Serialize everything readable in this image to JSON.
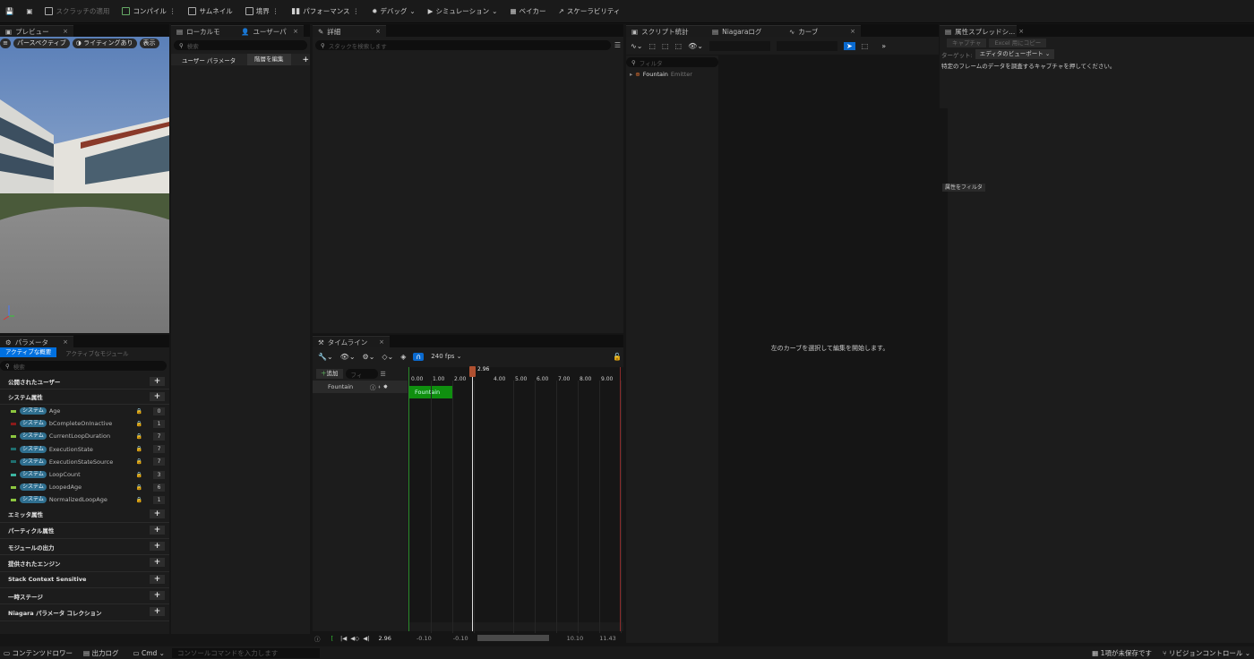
{
  "toolbar": {
    "items": [
      {
        "id": "scratch",
        "label": "スクラッチの適用",
        "disabled": true
      },
      {
        "id": "compile",
        "label": "コンパイル"
      },
      {
        "id": "thumbnail",
        "label": "サムネイル"
      },
      {
        "id": "bounds",
        "label": "境界"
      },
      {
        "id": "performance",
        "label": "パフォーマンス"
      },
      {
        "id": "debug",
        "label": "デバッグ"
      },
      {
        "id": "simulation",
        "label": "シミュレーション"
      },
      {
        "id": "baker",
        "label": "ベイカー"
      },
      {
        "id": "scalability",
        "label": "スケーラビリティ"
      }
    ]
  },
  "preview": {
    "tab_label": "プレビュー",
    "perspective_label": "パースペクティブ",
    "lighting_label": "ライティングあり",
    "show_label": "表示"
  },
  "local": {
    "tab1": "ローカルモ",
    "tab2": "ユーザーパ",
    "search_placeholder": "検索",
    "user_params_label": "ユーザー パラメータ",
    "edit_hierarchy_label": "階層を編集"
  },
  "details": {
    "tab_label": "詳細",
    "search_placeholder": "スタックを検索します"
  },
  "params": {
    "tab_label": "パラメータ",
    "active_overview": "アクティブな概要",
    "active_modules": "アクティブなモジュール",
    "search_placeholder": "検索",
    "cat_public_user": "公開されたユーザー",
    "cat_system": "システム属性",
    "rows": [
      {
        "tag": "システム",
        "name": "Age",
        "value": "0",
        "color": "#8cc63f"
      },
      {
        "tag": "システム",
        "name": "bCompleteOnInactive",
        "value": "1",
        "color": "#8b1a1a"
      },
      {
        "tag": "システム",
        "name": "CurrentLoopDuration",
        "value": "7",
        "color": "#8cc63f"
      },
      {
        "tag": "システム",
        "name": "ExecutionState",
        "value": "7",
        "color": "#1f6f6f"
      },
      {
        "tag": "システム",
        "name": "ExecutionStateSource",
        "value": "7",
        "color": "#1f6f6f"
      },
      {
        "tag": "システム",
        "name": "LoopCount",
        "value": "3",
        "color": "#3cb4a0"
      },
      {
        "tag": "システム",
        "name": "LoopedAge",
        "value": "6",
        "color": "#8cc63f"
      },
      {
        "tag": "システム",
        "name": "NormalizedLoopAge",
        "value": "1",
        "color": "#8cc63f"
      }
    ],
    "cats_after": [
      "エミッタ属性",
      "パーティクル属性",
      "モジュールの出力",
      "提供されたエンジン",
      "Stack Context Sensitive",
      "一時ステージ",
      "Niagara パラメータ コレクション"
    ]
  },
  "timeline": {
    "tab_label": "タイムライン",
    "fps_label": "240 fps",
    "add_label": "追加",
    "filter_placeholder": "フィ",
    "track_label": "Fountain",
    "clip_label": "Fountain",
    "playhead_label": "2.96",
    "ruler": [
      "0.00",
      "1.00",
      "2.00",
      "4.00",
      "5.00",
      "6.00",
      "7.00",
      "8.00",
      "9.00"
    ],
    "current_time": "2.96",
    "range_start": "-0.10",
    "range_start2": "-0.10",
    "range_end": "10.10",
    "range_end2": "11.43"
  },
  "script_stats": {
    "tab_label": "スクリプト統計",
    "filter_placeholder": "フィルタ",
    "tree_item": "Fountain",
    "tree_item_type": "Emitter"
  },
  "niagara_log": {
    "tab_label": "Niagaraログ"
  },
  "curves": {
    "tab_label": "カーブ",
    "empty_message": "左のカーブを選択して編集を開始します。"
  },
  "attr_sheet": {
    "tab_label": "属性スプレッドシ...",
    "capture_label": "キャプチャ",
    "copy_excel_label": "Excel 用にコピー",
    "target_label": "ターゲット:",
    "target_value": "エディタのビューポート",
    "hint": "特定のフレームのデータを調査するキャプチャを押してください。",
    "filter_label": "属性をフィルタ"
  },
  "statusbar": {
    "content_drawer": "コンテンツドロワー",
    "output_log": "出力ログ",
    "cmd": "Cmd",
    "console_placeholder": "コンソールコマンドを入力します",
    "unsaved": "1項が未保存です",
    "revision": "リビジョンコントロール"
  }
}
